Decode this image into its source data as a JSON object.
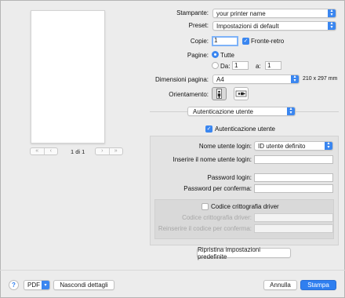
{
  "preview": {
    "page_counter": "1 di 1",
    "nav_first": "«",
    "nav_prev": "‹",
    "nav_next": "›",
    "nav_last": "»"
  },
  "printer": {
    "label": "Stampante:",
    "value": "your printer name"
  },
  "preset": {
    "label": "Preset:",
    "value": "Impostazioni di default"
  },
  "copies": {
    "label": "Copie:",
    "value": "1",
    "duplex_label": "Fronte-retro",
    "duplex_checked": true
  },
  "pages": {
    "label": "Pagine:",
    "all_label": "Tutte",
    "all_selected": true,
    "from_label": "Da:",
    "from_value": "1",
    "to_label": "a:",
    "to_value": "1"
  },
  "paper_size": {
    "label": "Dimensioni pagina:",
    "value": "A4",
    "dimensions": "210 x 297 mm"
  },
  "orientation": {
    "label": "Orientamento:",
    "selected": "portrait"
  },
  "section_popup": {
    "value": "Autenticazione utente"
  },
  "auth": {
    "enable_label": "Autenticazione utente",
    "enable_checked": true,
    "username_type_label": "Nome utente login:",
    "username_type_value": "ID utente definito",
    "username_label": "Inserire il nome utente login:",
    "username_value": "",
    "password_label": "Password login:",
    "password_value": "",
    "password_confirm_label": "Password per conferma:",
    "password_confirm_value": ""
  },
  "encryption": {
    "enable_label": "Codice crittografia driver",
    "enable_checked": false,
    "key_label": "Codice crittografia driver:",
    "key_confirm_label": "Reinserire il codice per conferma:"
  },
  "reset_button": "Ripristina impostazioni predefinite",
  "footer": {
    "help": "?",
    "pdf_label": "PDF",
    "hide_details": "Nascondi dettagli",
    "cancel": "Annulla",
    "print": "Stampa"
  },
  "colors": {
    "accent": "#2f7ff0",
    "window_bg": "#ececec",
    "panel_bg": "#e3e3e3"
  }
}
